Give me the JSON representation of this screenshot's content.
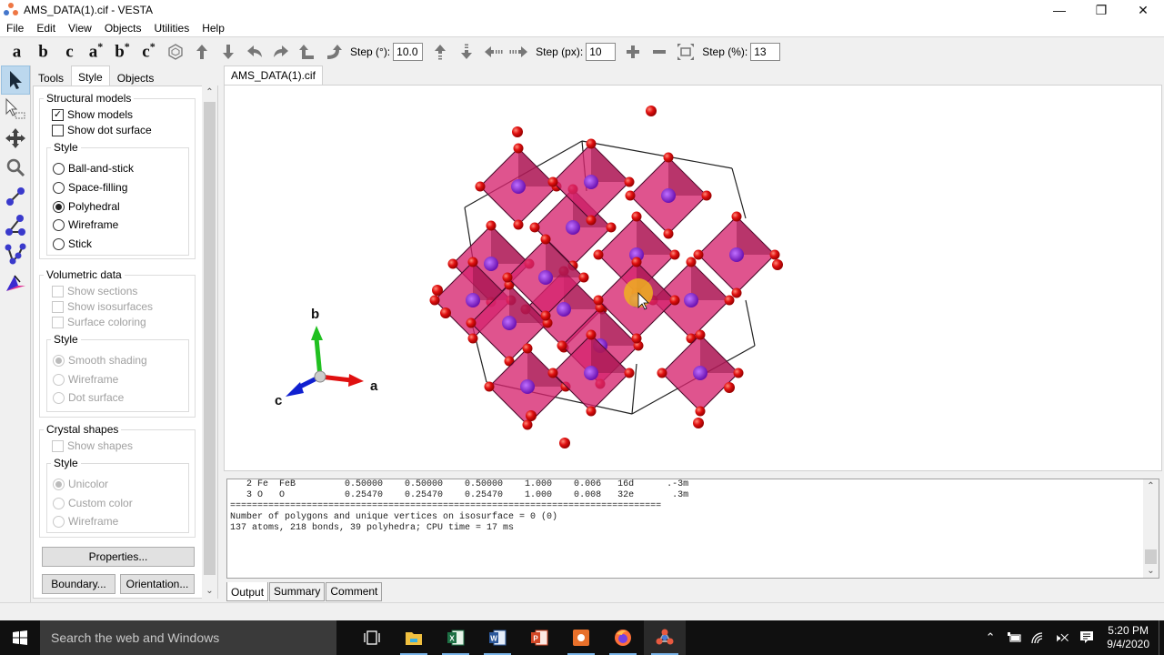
{
  "window": {
    "title": "AMS_DATA(1).cif - VESTA",
    "controls": {
      "minimize": "—",
      "restore": "❐",
      "close": "✕"
    }
  },
  "menu": [
    "File",
    "Edit",
    "View",
    "Objects",
    "Utilities",
    "Help"
  ],
  "toolbar": {
    "axes": [
      {
        "label": "a",
        "star": ""
      },
      {
        "label": "b",
        "star": ""
      },
      {
        "label": "c",
        "star": ""
      },
      {
        "label": "a",
        "star": "*"
      },
      {
        "label": "b",
        "star": "*"
      },
      {
        "label": "c",
        "star": "*"
      }
    ],
    "step_deg_label": "Step (°):",
    "step_deg_value": "10.0",
    "step_px_label": "Step (px):",
    "step_px_value": "10",
    "step_pct_label": "Step (%):",
    "step_pct_value": "13"
  },
  "left_tools": [
    "select",
    "region-select",
    "translate",
    "magnify",
    "distance",
    "angle",
    "dihedral",
    "lattice-plane"
  ],
  "panel": {
    "tabs": [
      "Tools",
      "Style",
      "Objects"
    ],
    "active_tab": "Style",
    "structural": {
      "title": "Structural models",
      "show_models": {
        "label": "Show models",
        "checked": true
      },
      "show_dot_surface": {
        "label": "Show dot surface",
        "checked": false
      },
      "style_title": "Style",
      "styles": [
        "Ball-and-stick",
        "Space-filling",
        "Polyhedral",
        "Wireframe",
        "Stick"
      ],
      "selected_style": "Polyhedral"
    },
    "volumetric": {
      "title": "Volumetric data",
      "show_sections": "Show sections",
      "show_isosurfaces": "Show isosurfaces",
      "surface_coloring": "Surface coloring",
      "style_title": "Style",
      "styles": [
        "Smooth shading",
        "Wireframe",
        "Dot surface"
      ],
      "selected_style": "Smooth shading"
    },
    "crystal": {
      "title": "Crystal shapes",
      "show_shapes": "Show shapes",
      "style_title": "Style",
      "styles": [
        "Unicolor",
        "Custom color",
        "Wireframe"
      ],
      "selected_style": "Unicolor"
    },
    "buttons": {
      "properties": "Properties...",
      "boundary": "Boundary...",
      "orientation": "Orientation..."
    }
  },
  "document_tab": "AMS_DATA(1).cif",
  "viewer": {
    "axes": {
      "a": "a",
      "b": "b",
      "c": "c"
    },
    "colors": {
      "polyhedra": "#d6246e",
      "oxygen": "#e01010",
      "cation": "#8a2ad0"
    }
  },
  "output": {
    "lines": [
      "   2 Fe  FeB         0.50000    0.50000    0.50000    1.000    0.006   16d      .-3m",
      "   3 O   O           0.25470    0.25470    0.25470    1.000    0.008   32e       .3m",
      "===============================================================================",
      "",
      "Number of polygons and unique vertices on isosurface = 0 (0)",
      "137 atoms, 218 bonds, 39 polyhedra; CPU time = 17 ms"
    ],
    "tabs": [
      "Output",
      "Summary",
      "Comment"
    ],
    "active_tab": "Output"
  },
  "taskbar": {
    "search_placeholder": "Search the web and Windows",
    "apps": [
      "task-view",
      "file-explorer",
      "excel",
      "word",
      "powerpoint",
      "screen-recorder",
      "firefox",
      "vesta"
    ],
    "time": "5:20 PM",
    "date": "9/4/2020"
  }
}
